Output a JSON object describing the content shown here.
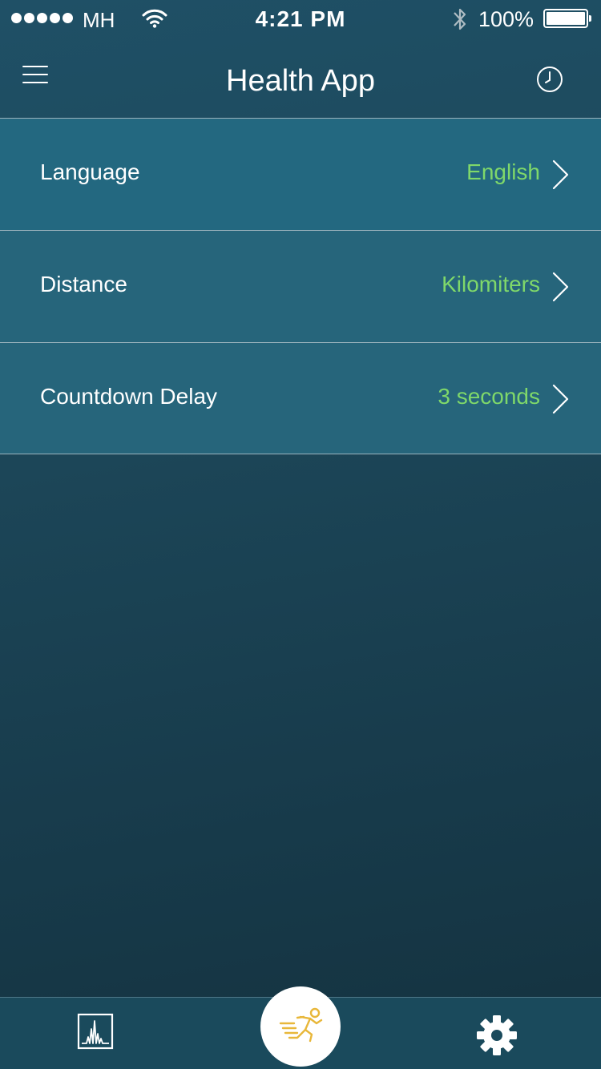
{
  "status_bar": {
    "carrier": "MH",
    "time": "4:21 PM",
    "battery_percent": "100%",
    "signal_bars": 5,
    "icons": [
      "signal-dots-icon",
      "wifi-icon",
      "bluetooth-icon",
      "battery-icon"
    ]
  },
  "nav": {
    "title": "Health App",
    "left_icon": "hamburger-menu-icon",
    "right_icon": "clock-history-icon"
  },
  "settings": [
    {
      "label": "Language",
      "value": "English"
    },
    {
      "label": "Distance",
      "value": "Kilomiters"
    },
    {
      "label": "Countdown Delay",
      "value": "3 seconds"
    }
  ],
  "tab_bar": {
    "items": [
      {
        "icon": "stats-chart-icon"
      },
      {
        "icon": "running-man-icon",
        "selected": true
      },
      {
        "icon": "gear-icon"
      }
    ]
  },
  "colors": {
    "background": "#1c4658",
    "row_background": "#26657b",
    "value_green": "#7fd86a",
    "run_icon_yellow": "#e8b73a",
    "tab_bar": "#1a4a5c"
  }
}
